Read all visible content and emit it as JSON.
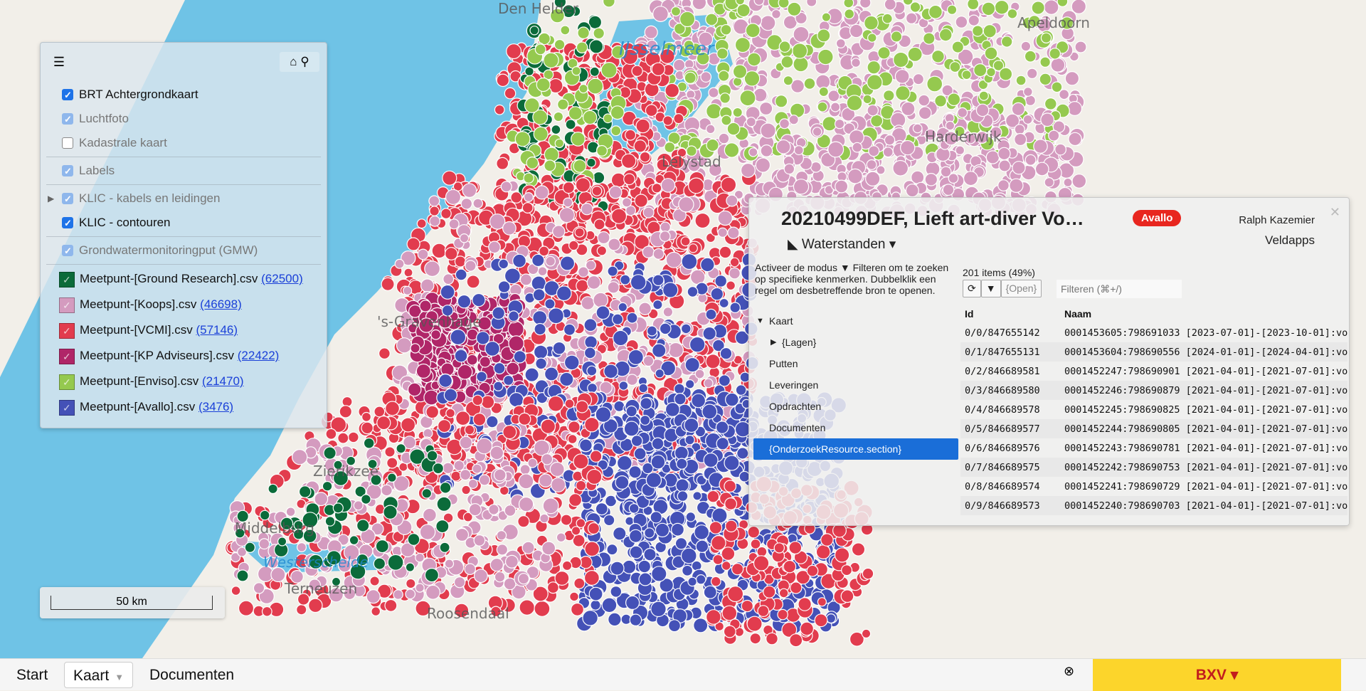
{
  "map": {
    "labels": [
      "Den Helder",
      "IJsselmeer",
      "Lelystad",
      "'s-Gravenhage",
      "Zierikzee",
      "Middelburg",
      "Westerschelde",
      "Terneuzen",
      "Roosendaal",
      "Harderwijk",
      "Apeldoorn"
    ],
    "colors": {
      "water": "#6fc3e6",
      "ground_research": "#0b6b3a",
      "koops": "#d49bbf",
      "vcmi": "#e23c4e",
      "kp": "#b02668",
      "enviso": "#95c94f",
      "avallo": "#4451b7"
    }
  },
  "layers": {
    "icons": {
      "menu": "menu-icon",
      "home": "home-icon",
      "search": "search-icon"
    },
    "base": [
      {
        "label": "BRT Achtergrondkaart",
        "checked": true,
        "dim": false
      },
      {
        "label": "Luchtfoto",
        "checked": true,
        "dim": true
      },
      {
        "label": "Kadastrale kaart",
        "checked": false,
        "dim": true
      },
      {
        "label": "Labels",
        "checked": true,
        "dim": true
      },
      {
        "label": "KLIC - kabels en leidingen",
        "checked": true,
        "dim": true
      },
      {
        "label": "KLIC - contouren",
        "checked": true,
        "dim": false
      },
      {
        "label": "Grondwatermonitoringput (GMW)",
        "checked": true,
        "dim": true
      }
    ],
    "measurements": [
      {
        "label": "Meetpunt-[Ground Research].csv",
        "count": "(62500)",
        "color": "#0b6b3a"
      },
      {
        "label": "Meetpunt-[Koops].csv",
        "count": "(46698)",
        "color": "#d49bbf"
      },
      {
        "label": "Meetpunt-[VCMI].csv",
        "count": "(57146)",
        "color": "#e23c4e"
      },
      {
        "label": "Meetpunt-[KP Adviseurs].csv",
        "count": "(22422)",
        "color": "#b02668"
      },
      {
        "label": "Meetpunt-[Enviso].csv",
        "count": "(21470)",
        "color": "#95c94f"
      },
      {
        "label": "Meetpunt-[Avallo].csv",
        "count": "(3476)",
        "color": "#4451b7"
      }
    ]
  },
  "scale": {
    "label": "50 km"
  },
  "detail": {
    "title": "20210499DEF, Lieft art-diver Vo…",
    "badge": "Avallo",
    "user": "Ralph Kazemier",
    "app": "Veldapps",
    "view": "Waterstanden",
    "hint": "Activeer de modus ▼ Filteren om te zoeken op specifieke kenmerken. Dubbelklik een regel om desbetreffende bron te openen.",
    "tree": {
      "root": "Kaart",
      "child": "{Lagen}",
      "items": [
        "Putten",
        "Leveringen",
        "Opdrachten",
        "Documenten"
      ],
      "selected": "{OnderzoekResource.section}"
    },
    "count": "201 items (49%)",
    "open_btn": "{Open}",
    "filter_placeholder": "Filteren (⌘+/)",
    "columns": [
      "Id",
      "Naam"
    ],
    "rows": [
      [
        "0/0/847655142",
        "0001453605:798691033 [2023-07-01]-[2023-10-01]:vo"
      ],
      [
        "0/1/847655131",
        "0001453604:798690556 [2024-01-01]-[2024-04-01]:vo"
      ],
      [
        "0/2/846689581",
        "0001452247:798690901 [2021-04-01]-[2021-07-01]:vo"
      ],
      [
        "0/3/846689580",
        "0001452246:798690879 [2021-04-01]-[2021-07-01]:vo"
      ],
      [
        "0/4/846689578",
        "0001452245:798690825 [2021-04-01]-[2021-07-01]:vo"
      ],
      [
        "0/5/846689577",
        "0001452244:798690805 [2021-04-01]-[2021-07-01]:vo"
      ],
      [
        "0/6/846689576",
        "0001452243:798690781 [2021-04-01]-[2021-07-01]:vo"
      ],
      [
        "0/7/846689575",
        "0001452242:798690753 [2021-04-01]-[2021-07-01]:vo"
      ],
      [
        "0/8/846689574",
        "0001452241:798690729 [2021-04-01]-[2021-07-01]:vo"
      ],
      [
        "0/9/846689573",
        "0001452240:798690703 [2021-04-01]-[2021-07-01]:vo"
      ]
    ]
  },
  "bottom": {
    "tabs": [
      "Start",
      "Kaart",
      "Documenten"
    ],
    "brand": "BXV"
  }
}
